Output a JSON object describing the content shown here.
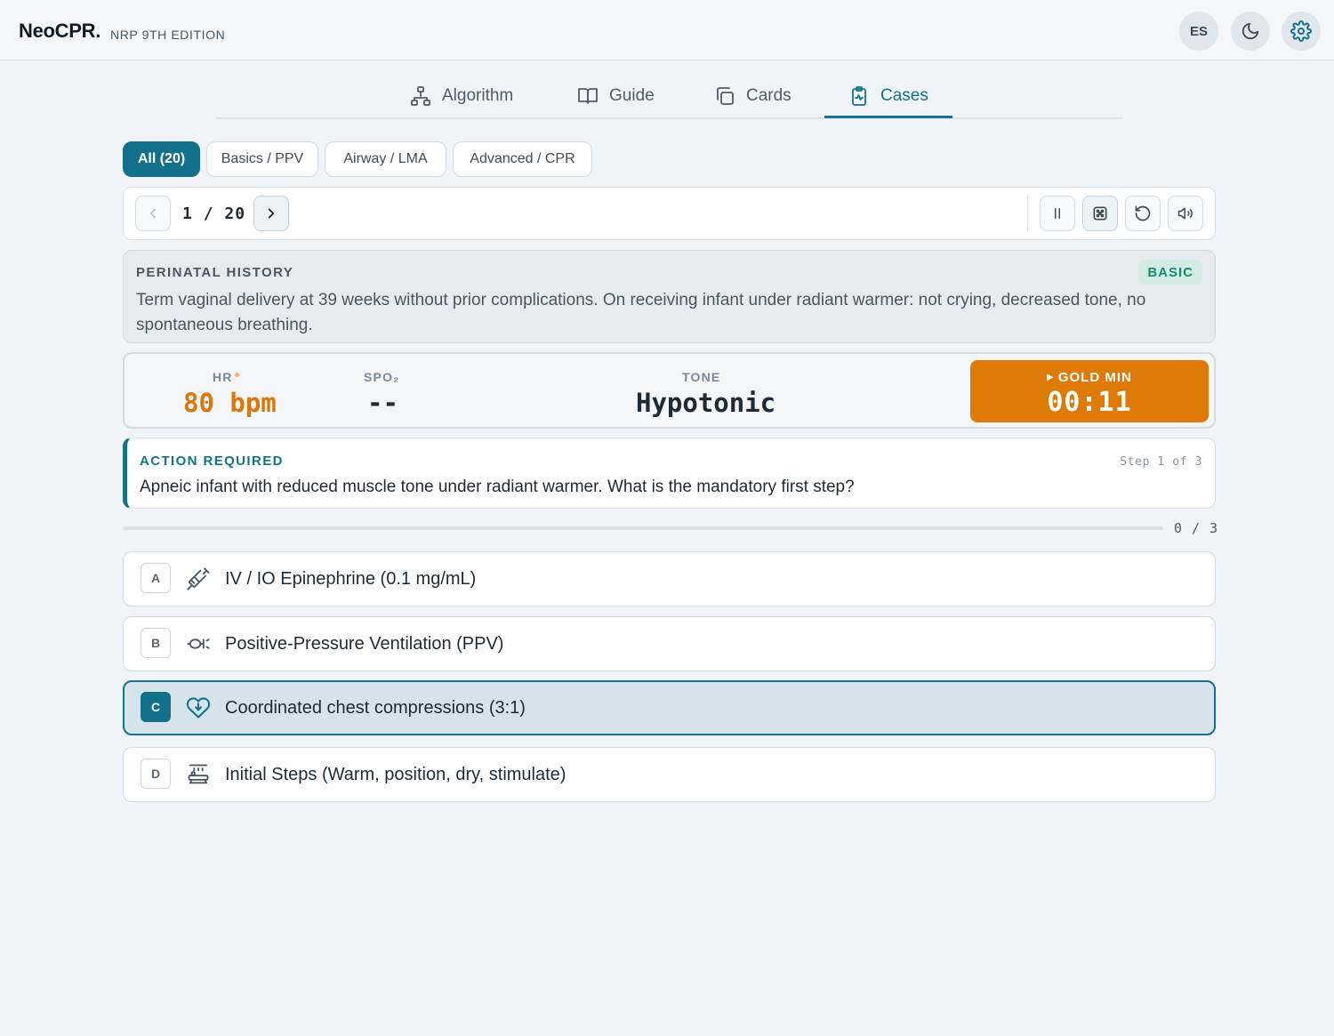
{
  "header": {
    "brand": "NeoCPR.",
    "edition": "NRP 9TH EDITION",
    "language_label": "ES"
  },
  "nav": {
    "tabs": [
      {
        "label": "Algorithm",
        "icon": "sitemap-icon",
        "active": false
      },
      {
        "label": "Guide",
        "icon": "book-icon",
        "active": false
      },
      {
        "label": "Cards",
        "icon": "cards-icon",
        "active": false
      },
      {
        "label": "Cases",
        "icon": "clipboard-pulse-icon",
        "active": true
      }
    ]
  },
  "filters": [
    "All (20)",
    "Basics / PPV",
    "Airway / LMA",
    "Advanced / CPR"
  ],
  "pager": {
    "current": "1",
    "separator": "/",
    "total": "20"
  },
  "history": {
    "title": "PERINATAL HISTORY",
    "text": "Term vaginal delivery at 39 weeks without prior complications. On receiving infant under radiant warmer: not crying, decreased tone, no spontaneous breathing.",
    "level": "BASIC"
  },
  "vitals": {
    "hr_label": "HR",
    "hr_value": "80 bpm",
    "spo2_label": "SPO₂",
    "spo2_value": "--",
    "tone_label": "TONE",
    "tone_value": "Hypotonic",
    "gold_label": "GOLD MIN",
    "gold_time": "00:11"
  },
  "action": {
    "title": "ACTION REQUIRED",
    "step": "Step 1 of 3",
    "question": "Apneic infant with reduced muscle tone under radiant warmer. What is the mandatory first step?"
  },
  "progress": {
    "text": "0 / 3",
    "fraction": 0
  },
  "options": [
    {
      "letter": "A",
      "label": "IV / IO Epinephrine (0.1 mg/mL)",
      "icon": "syringe-icon",
      "selected": false
    },
    {
      "letter": "B",
      "label": "Positive-Pressure Ventilation (PPV)",
      "icon": "ventilation-mask-icon",
      "selected": false
    },
    {
      "letter": "C",
      "label": "Coordinated chest compressions (3:1)",
      "icon": "heart-pulse-icon",
      "selected": true
    },
    {
      "letter": "D",
      "label": "Initial Steps (Warm, position, dry, stimulate)",
      "icon": "radiant-warmer-icon",
      "selected": false
    }
  ],
  "colors": {
    "accent": "#12738a",
    "gold_minute": "#de7a06",
    "hr_value": "#d9770a",
    "badge_text": "#138a6e"
  }
}
